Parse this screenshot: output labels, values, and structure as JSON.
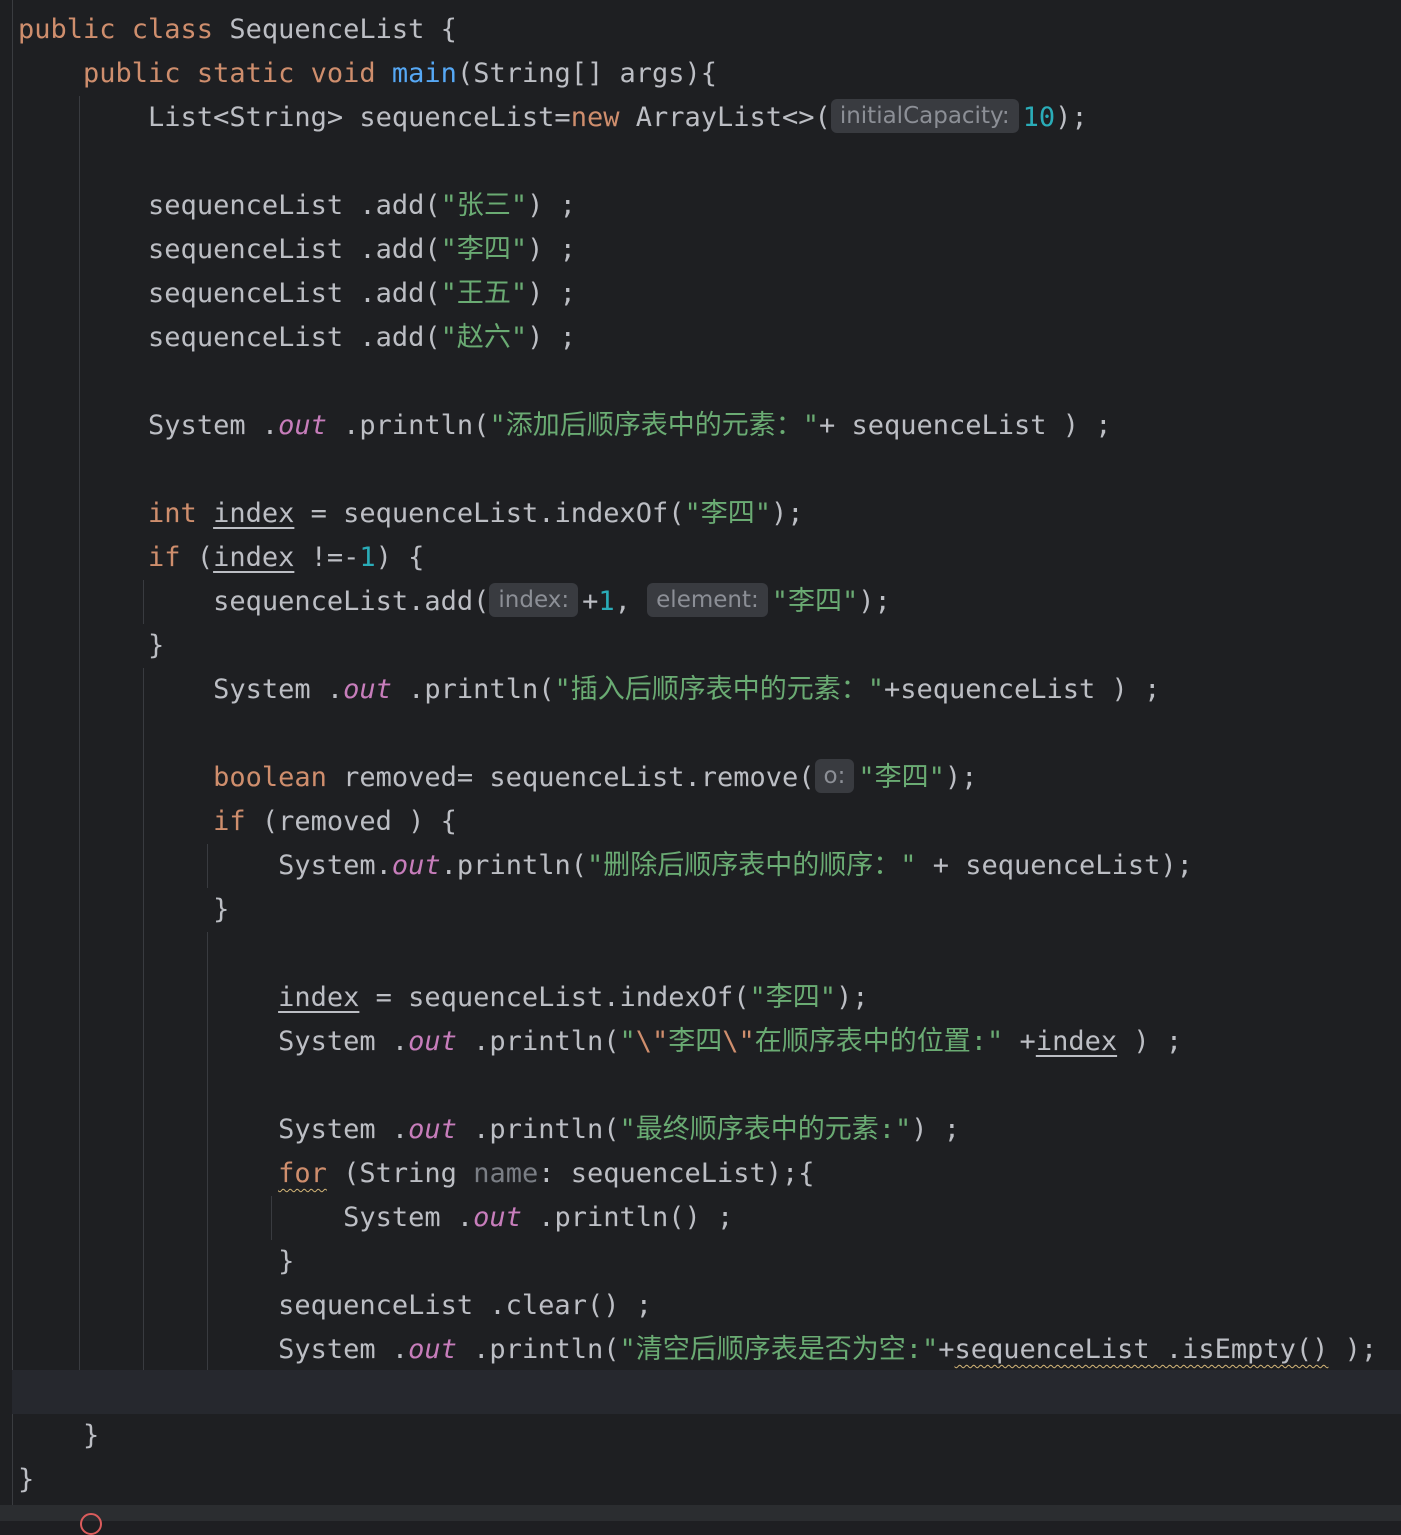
{
  "editor": {
    "language": "Java",
    "theme_colors": {
      "background": "#1e1f22",
      "keyword": "#cf8e6d",
      "method": "#56a8f5",
      "number": "#2aacb8",
      "string": "#6aab73",
      "static_field": "#c77dbb",
      "text": "#bcbec4"
    }
  },
  "code": {
    "l1": {
      "kw": "public class",
      "rest": "SequenceList {"
    },
    "l2": {
      "kw": "public static void",
      "fn": "main",
      "rest": "(String[] args){"
    },
    "l3": {
      "a": "List<String> sequenceList=",
      "kw": "new",
      "b": "ArrayList<>(",
      "hint": "initialCapacity:",
      "num": "10",
      "c": ");"
    },
    "l5": {
      "a": "sequenceList .add(",
      "str": "\"张三\"",
      "b": ") ;"
    },
    "l6": {
      "a": "sequenceList .add(",
      "str": "\"李四\"",
      "b": ") ;"
    },
    "l7": {
      "a": "sequenceList .add(",
      "str": "\"王五\"",
      "b": ") ;"
    },
    "l8": {
      "a": "sequenceList .add(",
      "str": "\"赵六\"",
      "b": ") ;"
    },
    "l10": {
      "a": "System .",
      "fld": "out",
      "b": " .println(",
      "str": "\"添加后顺序表中的元素：\"",
      "c": "+ sequenceList ) ;"
    },
    "l12": {
      "kw": "int",
      "var": "index",
      "b": " = sequenceList.indexOf(",
      "str": "\"李四\"",
      "c": ");"
    },
    "l13": {
      "kw": "if",
      "a": " (",
      "var": "index",
      "b": " !=-",
      "num": "1",
      "c": ") {"
    },
    "l14": {
      "a": "sequenceList.add(",
      "hint1": "index:",
      "b": "+",
      "num": "1",
      "c": ", ",
      "hint2": "element:",
      "str": "\"李四\"",
      "d": ");"
    },
    "l15": {
      "a": "}"
    },
    "l16": {
      "a": "System .",
      "fld": "out",
      "b": " .println(",
      "str": "\"插入后顺序表中的元素：\"",
      "c": "+sequenceList ) ;"
    },
    "l18": {
      "kw": "boolean",
      "a": " removed= sequenceList.remove(",
      "hint": "o:",
      "str": "\"李四\"",
      "b": ");"
    },
    "l19": {
      "kw": "if",
      "a": " (removed ) {"
    },
    "l20": {
      "a": "System.",
      "fld": "out",
      "b": ".println(",
      "str": "\"删除后顺序表中的顺序：\"",
      "c": " + sequenceList);"
    },
    "l21": {
      "a": "}"
    },
    "l23": {
      "var": "index",
      "a": " = sequenceList.indexOf(",
      "str": "\"李四\"",
      "b": ");"
    },
    "l24": {
      "a": "System .",
      "fld": "out",
      "b": " .println(",
      "s1": "\"",
      "e1": "\\\"",
      "s2": "李四",
      "e2": "\\\"",
      "s3": "在顺序表中的位置:\"",
      "c": " +",
      "var": "index",
      "d": " ) ;"
    },
    "l26": {
      "a": "System .",
      "fld": "out",
      "b": " .println(",
      "str": "\"最终顺序表中的元素:\"",
      "c": ") ;"
    },
    "l27": {
      "kw": "for",
      "a": " (String ",
      "unused": "name",
      "b": ": sequenceList);{"
    },
    "l28": {
      "a": "System .",
      "fld": "out",
      "b": " .println() ;"
    },
    "l29": {
      "a": "}"
    },
    "l30": {
      "a": "sequenceList .clear() ;"
    },
    "l31": {
      "a": "System .",
      "fld": "out",
      "b": " .println(",
      "str": "\"清空后顺序表是否为空:\"",
      "c": "+",
      "warn": "sequenceList .isEmpty()",
      "d": " );"
    },
    "l33": {
      "a": "}"
    },
    "l34": {
      "a": "}"
    }
  }
}
